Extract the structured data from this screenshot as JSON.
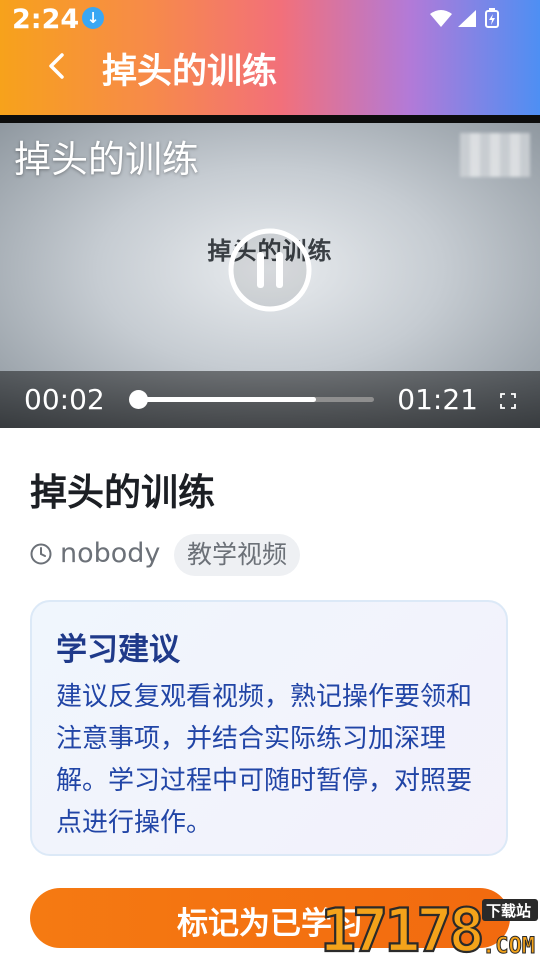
{
  "status_bar": {
    "time": "2:24",
    "download_icon": "download-arrow-icon",
    "icons": [
      "wifi-icon",
      "cell-signal-icon",
      "battery-charging-icon"
    ]
  },
  "header": {
    "title": "掉头的训练",
    "back_icon": "chevron-left-icon"
  },
  "video": {
    "overlay_title": "掉头的训练",
    "inner_text": "掉头的训练",
    "state_icon": "pause-icon",
    "current_time": "00:02",
    "total_time": "01:21",
    "played_fraction": 0.025,
    "buffered_fraction": 0.76,
    "fullscreen_icon": "fullscreen-icon"
  },
  "content": {
    "title": "掉头的训练",
    "author": "nobody",
    "tag": "教学视频"
  },
  "tip": {
    "title": "学习建议",
    "body": "建议反复观看视频，熟记操作要领和注意事项，并结合实际练习加深理解。学习过程中可随时暂停，对照要点进行操作。"
  },
  "action": {
    "mark_label": "标记为已学习"
  },
  "watermark": {
    "logo_text": "17178",
    "logo_subtext": "下载站",
    "logo_suffix": ".COM"
  },
  "colors": {
    "accent_orange": "#f57a12",
    "tip_text": "#2145a6",
    "header_gradient": [
      "#f7a21b",
      "#f2707a",
      "#4e8ff3"
    ]
  }
}
